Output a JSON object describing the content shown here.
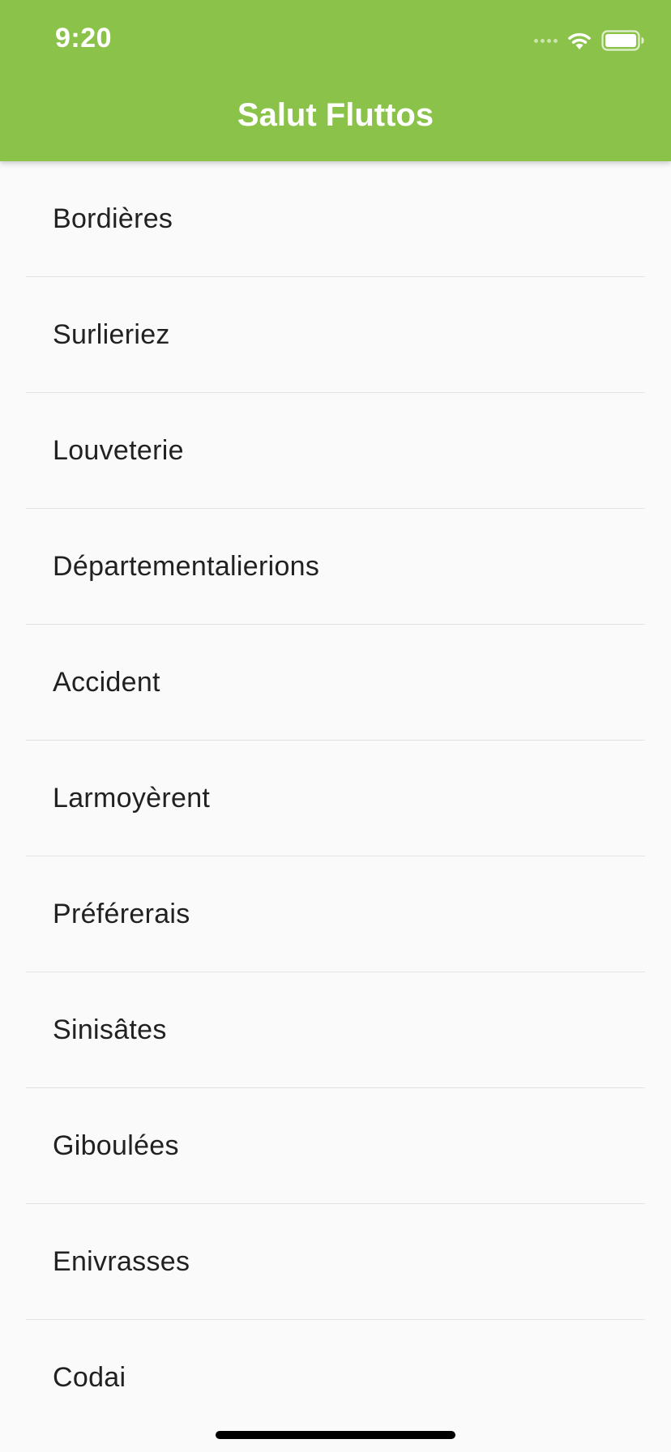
{
  "status_bar": {
    "time": "9:20"
  },
  "app_bar": {
    "title": "Salut Fluttos",
    "color": "#8BC34A"
  },
  "list": {
    "items": [
      "Bordières",
      "Surlieriez",
      "Louveterie",
      "Départementalierions",
      "Accident",
      "Larmoyèrent",
      "Préférerais",
      "Sinisâtes",
      "Giboulées",
      "Enivrasses",
      "Codai"
    ]
  },
  "icons": {
    "signal": "signal-icon",
    "wifi": "wifi-icon",
    "battery": "battery-icon"
  }
}
